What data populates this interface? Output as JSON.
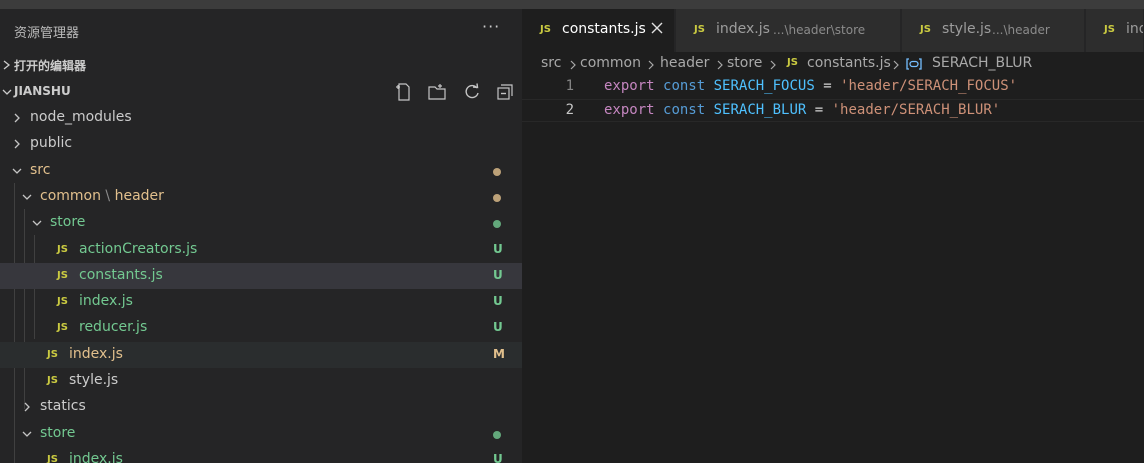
{
  "explorer": {
    "title": "资源管理器",
    "more": "···",
    "open_editors_label": "打开的编辑器",
    "project_label": "JIANSHU"
  },
  "tree": [
    {
      "name": "node_modules",
      "type": "folder",
      "expanded": false,
      "status": ""
    },
    {
      "name": "public",
      "type": "folder",
      "expanded": false,
      "status": ""
    },
    {
      "name": "src",
      "type": "folder",
      "expanded": true,
      "status": "dot",
      "color": "#e2c08d"
    },
    {
      "name": "common",
      "name_suffix": "header",
      "type": "folder",
      "expanded": true,
      "status": "dot",
      "color": "#e2c08d"
    },
    {
      "name": "store",
      "type": "folder",
      "expanded": true,
      "status": "dot",
      "color": "#73c991"
    },
    {
      "name": "actionCreators.js",
      "type": "js",
      "status": "U",
      "color": "#73c991"
    },
    {
      "name": "constants.js",
      "type": "js",
      "status": "U",
      "color": "#73c991",
      "selected": true
    },
    {
      "name": "index.js",
      "type": "js",
      "status": "U",
      "color": "#73c991"
    },
    {
      "name": "reducer.js",
      "type": "js",
      "status": "U",
      "color": "#73c991"
    },
    {
      "name": "index.js",
      "type": "js",
      "status": "M",
      "color": "#e2c08d",
      "hover": true
    },
    {
      "name": "style.js",
      "type": "js",
      "status": ""
    },
    {
      "name": "statics",
      "type": "folder",
      "expanded": false,
      "status": ""
    },
    {
      "name": "store",
      "type": "folder",
      "expanded": true,
      "status": "dot",
      "color": "#73c991"
    },
    {
      "name": "index.js",
      "type": "js",
      "status": "U",
      "color": "#73c991"
    }
  ],
  "tabs": [
    {
      "icon": "JS",
      "name": "constants.js",
      "desc": "",
      "active": true
    },
    {
      "icon": "JS",
      "name": "index.js",
      "desc": "...\\header\\store",
      "active": false
    },
    {
      "icon": "JS",
      "name": "style.js",
      "desc": "...\\header",
      "active": false
    },
    {
      "icon": "JS",
      "name": "ind",
      "desc": "",
      "active": false
    }
  ],
  "breadcrumbs": {
    "parts": [
      "src",
      "common",
      "header",
      "store"
    ],
    "file_icon": "JS",
    "file": "constants.js",
    "symbol": "SERACH_BLUR"
  },
  "code": [
    {
      "num": "1",
      "tokens": [
        [
          "kw",
          "export"
        ],
        [
          "op",
          " "
        ],
        [
          "kw2",
          "const"
        ],
        [
          "op",
          " "
        ],
        [
          "const",
          "SERACH_FOCUS"
        ],
        [
          "op",
          " = "
        ],
        [
          "str",
          "'header/SERACH_FOCUS'"
        ]
      ]
    },
    {
      "num": "2",
      "tokens": [
        [
          "kw",
          "export"
        ],
        [
          "op",
          " "
        ],
        [
          "kw2",
          "const"
        ],
        [
          "op",
          " "
        ],
        [
          "const",
          "SERACH_BLUR"
        ],
        [
          "op",
          " = "
        ],
        [
          "str",
          "'header/SERACH_BLUR'"
        ]
      ],
      "current": true
    }
  ],
  "colors": {
    "untracked": "#73c991",
    "modified": "#e2c08d",
    "js_icon": "#cbcb41"
  }
}
